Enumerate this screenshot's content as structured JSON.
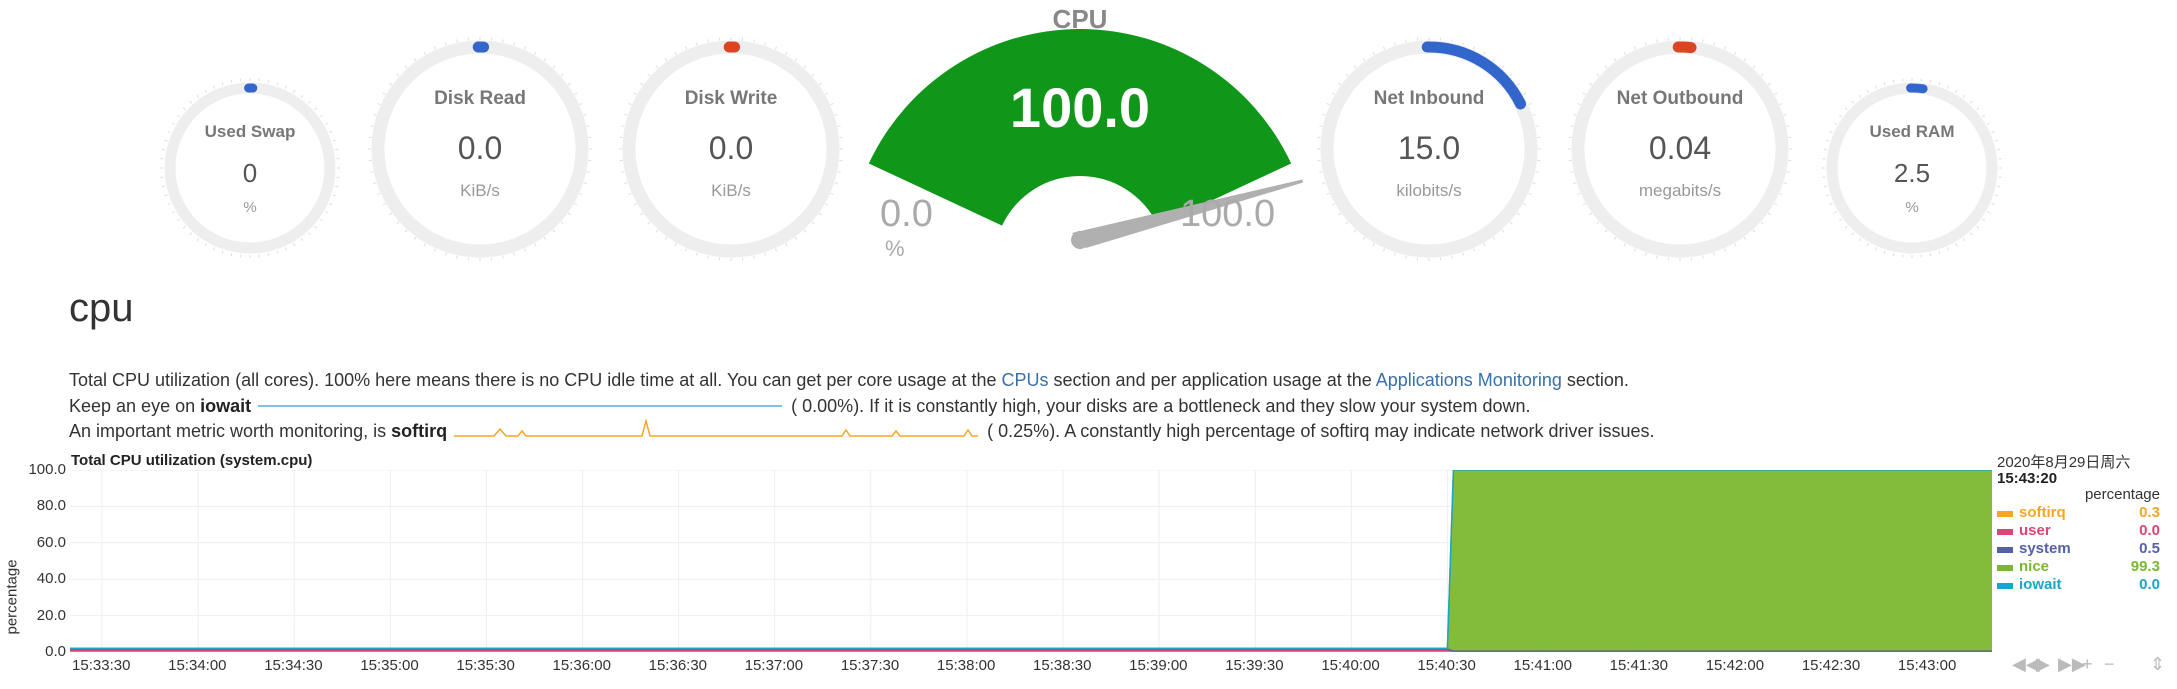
{
  "gauges": {
    "swap": {
      "title": "Used Swap",
      "value": "0",
      "unit": "%",
      "fraction": 0.0,
      "arc_color": "#3366cc"
    },
    "diskread": {
      "title": "Disk Read",
      "value": "0.0",
      "unit": "KiB/s",
      "fraction": 0.0,
      "arc_color": "#3366cc"
    },
    "diskwrite": {
      "title": "Disk Write",
      "value": "0.0",
      "unit": "KiB/s",
      "fraction": 0.0,
      "arc_color": "#dd4422"
    },
    "netin": {
      "title": "Net Inbound",
      "value": "15.0",
      "unit": "kilobits/s",
      "fraction": 0.18,
      "arc_color": "#3366cc"
    },
    "netout": {
      "title": "Net Outbound",
      "value": "0.04",
      "unit": "megabits/s",
      "fraction": 0.02,
      "arc_color": "#dd4422"
    },
    "ram": {
      "title": "Used RAM",
      "value": "2.5",
      "unit": "%",
      "fraction": 0.025,
      "arc_color": "#3366cc"
    }
  },
  "cpu_gauge": {
    "title": "CPU",
    "value": "100.0",
    "min": "0.0",
    "max": "100.0",
    "unit": "%",
    "fraction": 1.0,
    "fill_color": "#109618"
  },
  "section": {
    "title": "cpu",
    "line1_pre": "Total CPU utilization (all cores). 100% here means there is no CPU idle time at all. You can get per core usage at the ",
    "line1_link1": "CPUs",
    "line1_mid": " section and per application usage at the ",
    "line1_link2": "Applications Monitoring",
    "line1_post": " section.",
    "line2_pre": "Keep an eye on ",
    "line2_bold": "iowait",
    "line2_pct": "(      0.00%). If it is constantly high, your disks are a bottleneck and they slow your system down.",
    "line3_pre": "An important metric worth monitoring, is ",
    "line3_bold": "softirq",
    "line3_pct": "(      0.25%). A constantly high percentage of softirq may indicate network driver issues."
  },
  "chart_title": "Total CPU utilization (system.cpu)",
  "chart_data": {
    "type": "area",
    "title": "Total CPU utilization (system.cpu)",
    "ylabel": "percentage",
    "ylim": [
      0,
      100
    ],
    "yticks": [
      "0.0",
      "20.0",
      "40.0",
      "60.0",
      "80.0",
      "100.0"
    ],
    "xticks": [
      "15:33:30",
      "15:34:00",
      "15:34:30",
      "15:35:00",
      "15:35:30",
      "15:36:00",
      "15:36:30",
      "15:37:00",
      "15:37:30",
      "15:38:00",
      "15:38:30",
      "15:39:00",
      "15:39:30",
      "15:40:00",
      "15:40:30",
      "15:41:00",
      "15:41:30",
      "15:42:00",
      "15:42:30",
      "15:43:00"
    ],
    "x_start": "15:33:20",
    "x_end": "15:43:20",
    "step_time": "15:40:30",
    "series": [
      {
        "name": "softirq",
        "before": 0.3,
        "after": 0.3,
        "color": "#f5a623"
      },
      {
        "name": "user",
        "before": 0.8,
        "after": 0.0,
        "color": "#dd4477"
      },
      {
        "name": "system",
        "before": 0.9,
        "after": 0.5,
        "color": "#5560aa"
      },
      {
        "name": "nice",
        "before": 0.0,
        "after": 99.3,
        "color": "#7cb82f"
      },
      {
        "name": "iowait",
        "before": 0.0,
        "after": 0.0,
        "color": "#1aa6c9"
      }
    ]
  },
  "legend": {
    "date": "2020年8月29日周六",
    "time": "15:43:20",
    "units": "percentage",
    "items": [
      {
        "name": "softirq",
        "value": "0.3",
        "color": "#f5a623"
      },
      {
        "name": "user",
        "value": "0.0",
        "color": "#dd4477"
      },
      {
        "name": "system",
        "value": "0.5",
        "color": "#5560aa"
      },
      {
        "name": "nice",
        "value": "99.3",
        "color": "#7cb82f"
      },
      {
        "name": "iowait",
        "value": "0.0",
        "color": "#1aa6c9"
      }
    ]
  },
  "controls": [
    "◀◀",
    "▶",
    "▶▶",
    "+",
    "−",
    "⇕"
  ]
}
